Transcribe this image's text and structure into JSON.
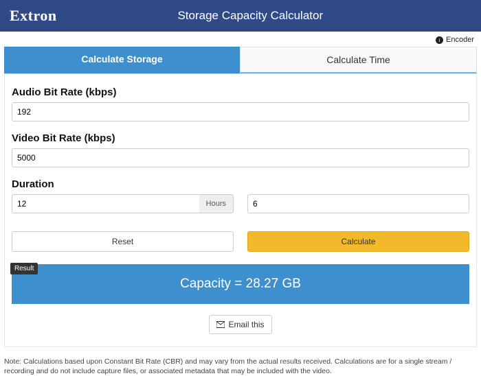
{
  "header": {
    "brand": "Extron",
    "title": "Storage Capacity Calculator"
  },
  "encoder": {
    "label": "Encoder"
  },
  "tabs": {
    "storage": "Calculate Storage",
    "time": "Calculate Time"
  },
  "fields": {
    "audio": {
      "label": "Audio Bit Rate (kbps)",
      "value": "192"
    },
    "video": {
      "label": "Video Bit Rate (kbps)",
      "value": "5000"
    },
    "duration": {
      "label": "Duration",
      "hours": "12",
      "unit": "Hours",
      "minutes": "6"
    }
  },
  "buttons": {
    "reset": "Reset",
    "calculate": "Calculate",
    "email": "Email this"
  },
  "result": {
    "tag": "Result",
    "text": "Capacity = 28.27 GB"
  },
  "note": "Note: Calculations based upon Constant Bit Rate (CBR) and may vary from the actual results received. Calculations are for a single stream / recording and do not include capture files, or associated metadata that may be included with the video."
}
